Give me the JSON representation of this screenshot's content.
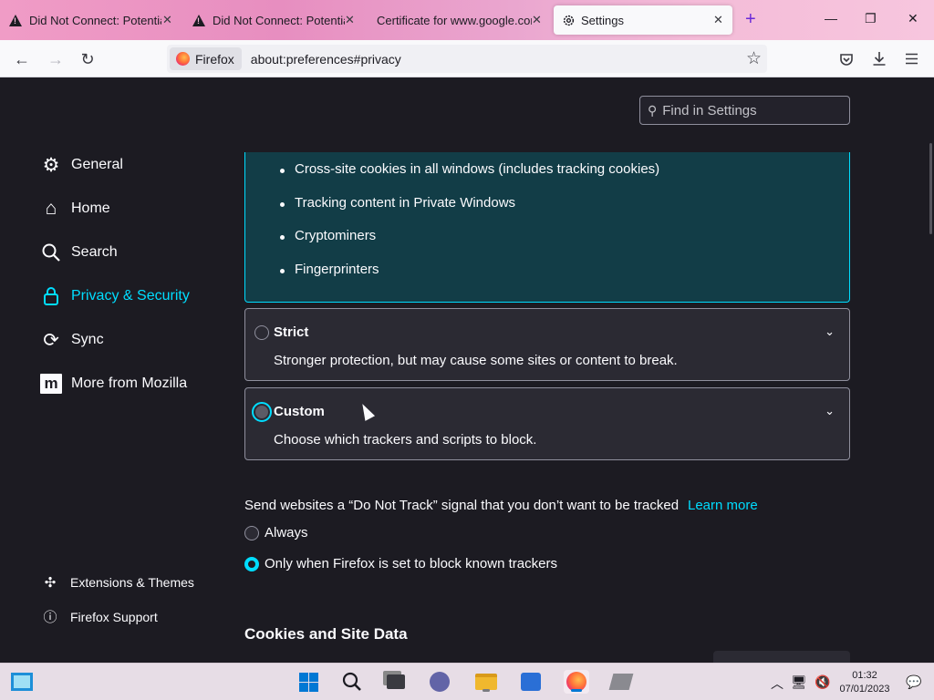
{
  "tabs": [
    {
      "title": "Did Not Connect: Potential Security Issue",
      "close": "✕",
      "icon": "warning-icon"
    },
    {
      "title": "Did Not Connect: Potential Security Issue",
      "close": "✕",
      "icon": "warning-icon"
    },
    {
      "title": "Certificate for www.google.com",
      "close": "✕"
    },
    {
      "title": "Settings",
      "close": "✕",
      "icon": "gear-icon",
      "active": true
    }
  ],
  "toolbar": {
    "identity_label": "Firefox",
    "url": "about:preferences#privacy"
  },
  "settings": {
    "find_placeholder": "Find in Settings",
    "categories": [
      {
        "label": "General",
        "icon": "gear-icon"
      },
      {
        "label": "Home",
        "icon": "home-icon"
      },
      {
        "label": "Search",
        "icon": "search-icon"
      },
      {
        "label": "Privacy & Security",
        "icon": "lock-icon",
        "active": true
      },
      {
        "label": "Sync",
        "icon": "sync-icon"
      },
      {
        "label": "More from Mozilla",
        "icon": "mozilla-icon"
      }
    ],
    "footer_links": [
      {
        "label": "Extensions & Themes",
        "icon": "puzzle-icon"
      },
      {
        "label": "Firefox Support",
        "icon": "help-icon"
      }
    ],
    "standard_blocked": [
      "Cross-site cookies in all windows (includes tracking cookies)",
      "Tracking content in Private Windows",
      "Cryptominers",
      "Fingerprinters"
    ],
    "strict": {
      "title": "Strict",
      "desc": "Stronger protection, but may cause some sites or content to break."
    },
    "custom": {
      "title": "Custom",
      "desc": "Choose which trackers and scripts to block."
    },
    "dnt": {
      "label": "Send websites a “Do Not Track” signal that you don’t want to be tracked",
      "learn_more": "Learn more",
      "options": [
        "Always",
        "Only when Firefox is set to block known trackers"
      ],
      "selected": 1
    },
    "cookies_heading": "Cookies and Site Data"
  },
  "taskbar": {
    "time": "01:32",
    "date": "07/01/2023"
  },
  "colors": {
    "accent": "#00ddff",
    "background": "#1c1b22",
    "panel": "#2b2a33"
  }
}
